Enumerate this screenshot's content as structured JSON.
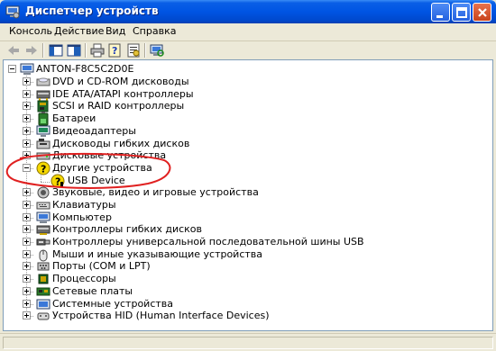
{
  "window": {
    "title": "Диспетчер устройств",
    "title_icon": "device-manager-icon",
    "controls": [
      "minimize-icon",
      "maximize-icon",
      "close-icon"
    ]
  },
  "menu": {
    "items": [
      "Консоль",
      "Действие",
      "Вид",
      "Справка"
    ]
  },
  "toolbar": {
    "buttons": [
      "back-arrow-icon",
      "forward-arrow-icon",
      "show-hide-console-tree-icon",
      "print-icon",
      "help-icon",
      "properties-icon",
      "scan-hardware-icon"
    ]
  },
  "tree": {
    "root": "ANTON-F8C5C2D0E",
    "items": [
      {
        "label": "DVD и CD-ROM дисководы",
        "icon": "cdrom-drive-icon",
        "expanded": false
      },
      {
        "label": "IDE ATA/ATAPI контроллеры",
        "icon": "ide-controller-icon",
        "expanded": false
      },
      {
        "label": "SCSI и RAID контроллеры",
        "icon": "scsi-controller-icon",
        "expanded": false
      },
      {
        "label": "Батареи",
        "icon": "battery-icon",
        "expanded": false
      },
      {
        "label": "Видеоадаптеры",
        "icon": "display-adapter-icon",
        "expanded": false
      },
      {
        "label": "Дисководы гибких дисков",
        "icon": "floppy-drive-icon",
        "expanded": false
      },
      {
        "label": "Дисковые устройства",
        "icon": "disk-drive-icon",
        "expanded": false
      },
      {
        "label": "Другие устройства",
        "icon": "unknown-device-icon",
        "expanded": true,
        "children": [
          {
            "label": "USB Device",
            "icon": "warning-device-icon"
          }
        ]
      },
      {
        "label": "Звуковые, видео и игровые устройства",
        "icon": "sound-device-icon",
        "expanded": false
      },
      {
        "label": "Клавиатуры",
        "icon": "keyboard-icon",
        "expanded": false
      },
      {
        "label": "Компьютер",
        "icon": "computer-icon",
        "expanded": false
      },
      {
        "label": "Контроллеры гибких дисков",
        "icon": "floppy-controller-icon",
        "expanded": false
      },
      {
        "label": "Контроллеры универсальной последовательной шины USB",
        "icon": "usb-controller-icon",
        "expanded": false
      },
      {
        "label": "Мыши и иные указывающие устройства",
        "icon": "mouse-icon",
        "expanded": false
      },
      {
        "label": "Порты (COM и LPT)",
        "icon": "port-icon",
        "expanded": false
      },
      {
        "label": "Процессоры",
        "icon": "processor-icon",
        "expanded": false
      },
      {
        "label": "Сетевые платы",
        "icon": "network-adapter-icon",
        "expanded": false
      },
      {
        "label": "Системные устройства",
        "icon": "system-device-icon",
        "expanded": false
      },
      {
        "label": "Устройства HID (Human Interface Devices)",
        "icon": "hid-device-icon",
        "expanded": false
      }
    ]
  },
  "annotation": {
    "shape": "ellipse",
    "color": "#e02020",
    "target": "Другие устройства"
  },
  "colors": {
    "titlebar": "#0054e3",
    "chrome": "#ece9d8",
    "warning": "#f5d800"
  }
}
